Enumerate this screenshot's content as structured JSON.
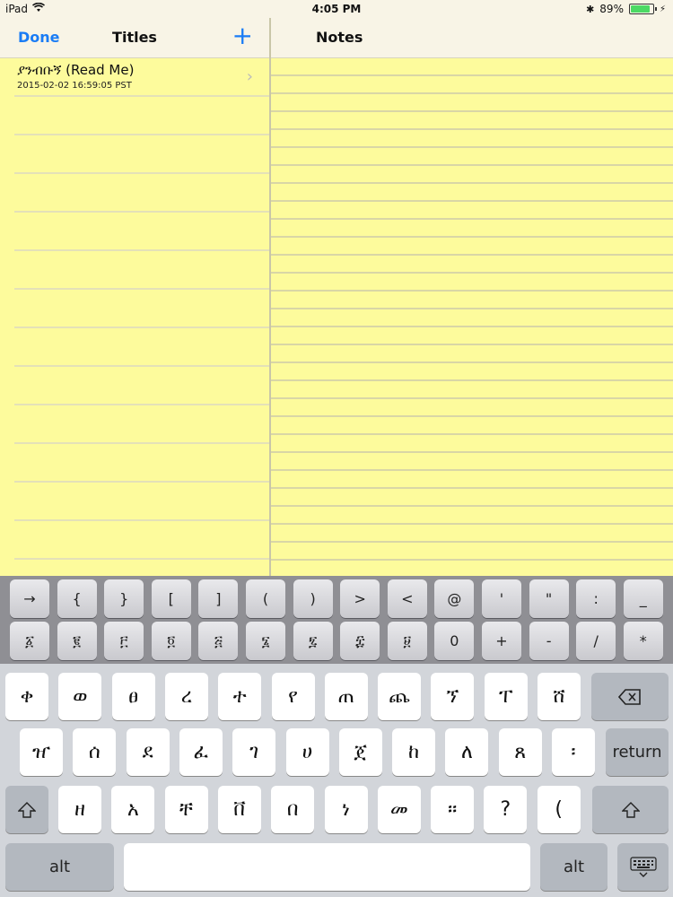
{
  "status": {
    "device": "iPad",
    "time": "4:05 PM",
    "battery": "89%",
    "battery_level": 0.89
  },
  "titles_nav": {
    "done": "Done",
    "title": "Titles",
    "add": "+"
  },
  "notes_nav": {
    "title": "Notes"
  },
  "notes_list": [
    {
      "title": "ያንብቡኝ (Read Me)",
      "date": "2015-02-02 16:59:05 PST"
    }
  ],
  "keyboard": {
    "row1": [
      "→",
      "{",
      "}",
      "[",
      "]",
      "(",
      ")",
      ">",
      "<",
      "@",
      "'",
      "\"",
      ":",
      "_"
    ],
    "row2": [
      "፩",
      "፪",
      "፫",
      "፬",
      "፭",
      "፮",
      "፯",
      "፰",
      "፱",
      "0",
      "+",
      "-",
      "/",
      "*"
    ],
    "row3": [
      "ቀ",
      "ወ",
      "ፀ",
      "ረ",
      "ተ",
      "የ",
      "ጠ",
      "ጨ",
      "ኘ",
      "ፐ",
      "ሸ"
    ],
    "row4": [
      "ዠ",
      "ሰ",
      "ደ",
      "ፈ",
      "ገ",
      "ሀ",
      "ጀ",
      "ከ",
      "ለ",
      "ጸ",
      "፡"
    ],
    "row5": [
      "ዘ",
      "አ",
      "ቸ",
      "ቨ",
      "በ",
      "ነ",
      "መ",
      "።",
      "?",
      "("
    ],
    "return": "return",
    "alt": "alt",
    "backspace_icon": "backspace-icon",
    "shift_icon": "shift-icon",
    "dismiss_icon": "keyboard-dismiss-icon"
  },
  "colors": {
    "accent": "#1a7cf5",
    "paper": "#fdfb9c"
  }
}
